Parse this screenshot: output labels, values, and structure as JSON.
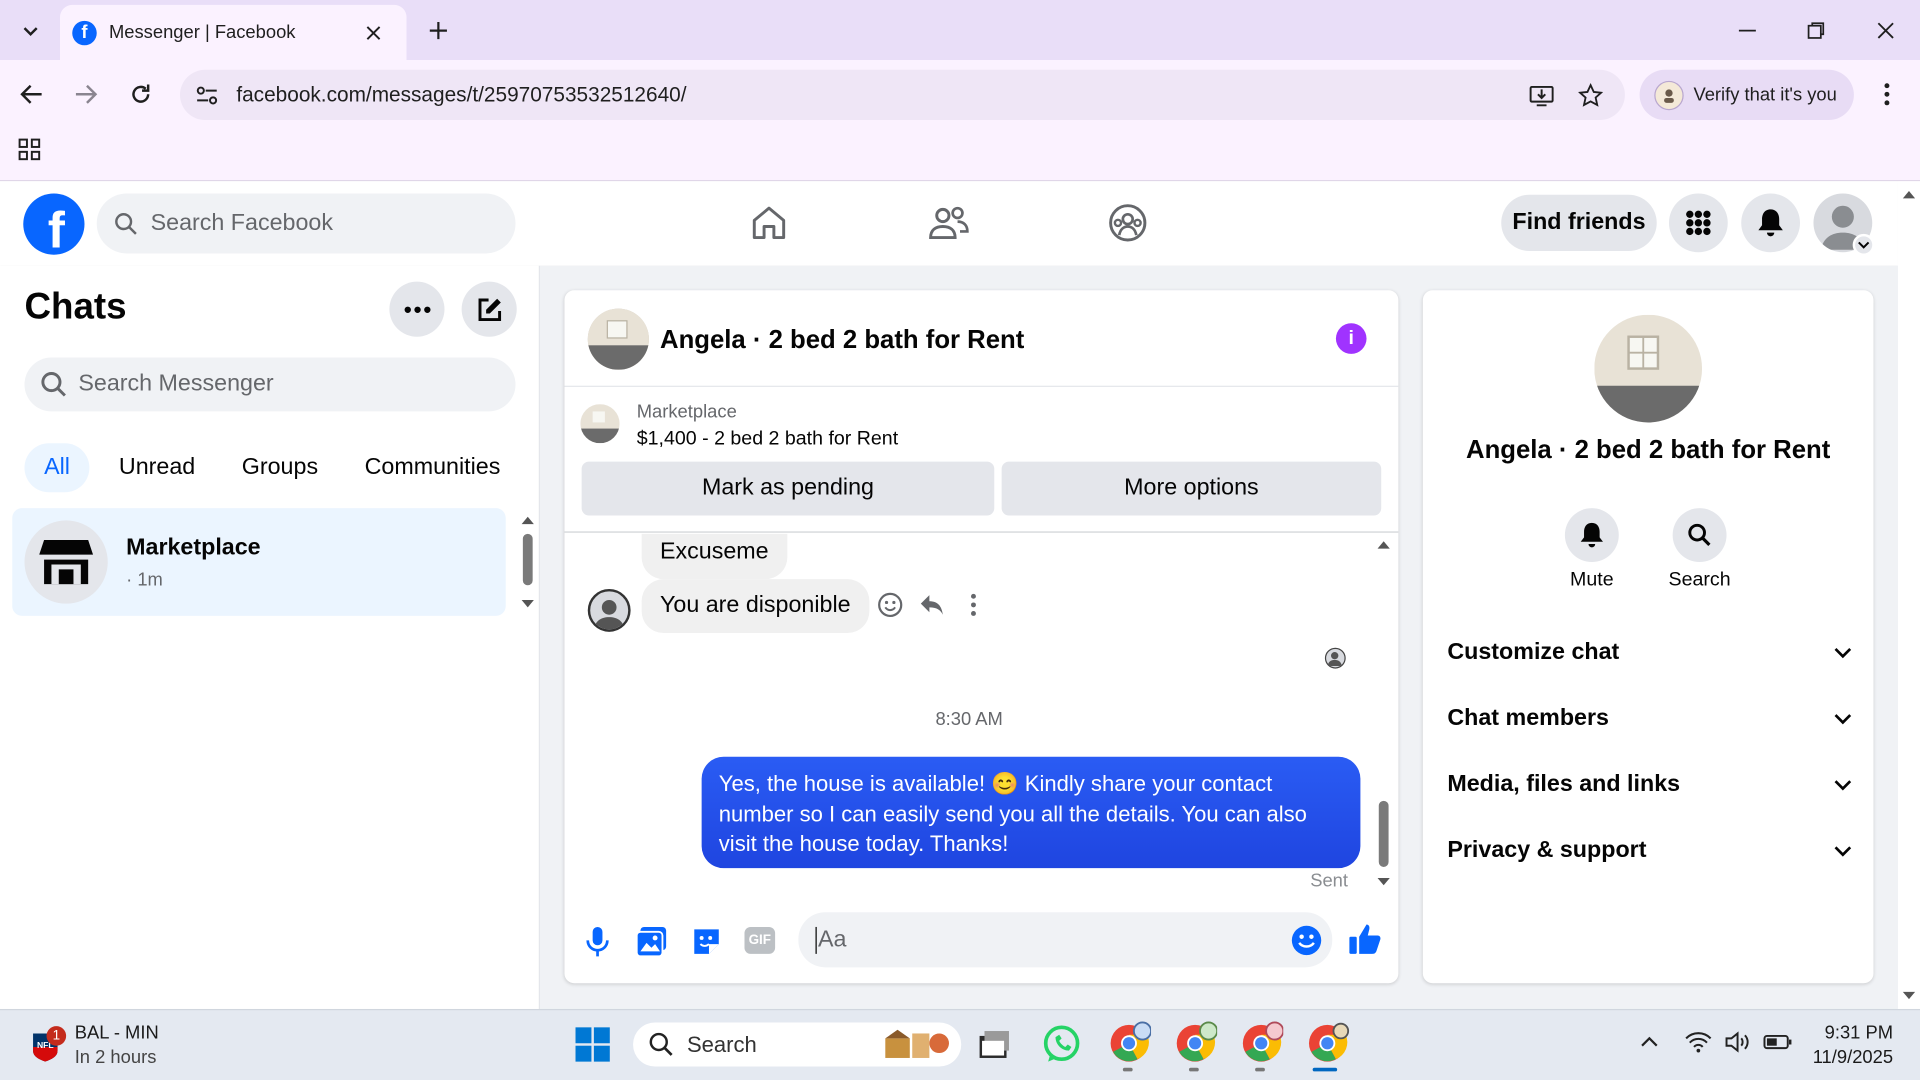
{
  "browser": {
    "tab_title": "Messenger | Facebook",
    "url": "facebook.com/messages/t/25970753532512640/",
    "verify_label": "Verify that it's you"
  },
  "fb": {
    "search_placeholder": "Search Facebook",
    "find_friends": "Find friends"
  },
  "left": {
    "title": "Chats",
    "search_placeholder": "Search Messenger",
    "filters": [
      "All",
      "Unread",
      "Groups",
      "Communities"
    ],
    "chat": {
      "name": "Marketplace",
      "time": "· 1m"
    }
  },
  "conversation": {
    "title": "Angela · 2 bed 2 bath for Rent",
    "listing_source": "Marketplace",
    "listing_title": "$1,400 - 2 bed 2 bath for Rent",
    "mark_pending": "Mark as pending",
    "more_options": "More options",
    "msg1": "Excuseme",
    "msg2": "You are disponible",
    "timestamp": "8:30 AM",
    "outgoing": "Yes, the house is available! 😊 Kindly share your contact number so I can easily send you all the details. You can also visit the house today. Thanks!",
    "sent_label": "Sent",
    "input_placeholder": "Aa"
  },
  "info": {
    "name": "Angela · 2 bed 2 bath for Rent",
    "mute": "Mute",
    "search": "Search",
    "sections": [
      "Customize chat",
      "Chat members",
      "Media, files and links",
      "Privacy & support"
    ]
  },
  "taskbar": {
    "widget_title": "BAL - MIN",
    "widget_sub": "In 2 hours",
    "widget_badge": "1",
    "search_label": "Search",
    "time": "9:31 PM",
    "date": "11/9/2025"
  },
  "colors": {
    "fb_blue": "#0866ff",
    "messenger_blue": "#1f45e0",
    "info_purple": "#a033ff"
  }
}
